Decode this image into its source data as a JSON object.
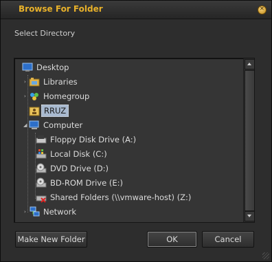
{
  "window": {
    "title": "Browse For Folder"
  },
  "label": "Select Directory",
  "tree": {
    "items": [
      {
        "label": "Desktop",
        "icon": "desktop-icon"
      },
      {
        "label": "Libraries",
        "icon": "libraries-icon"
      },
      {
        "label": "Homegroup",
        "icon": "homegroup-icon"
      },
      {
        "label": "RRUZ",
        "icon": "user-folder-icon",
        "selected": true
      },
      {
        "label": "Computer",
        "icon": "computer-icon",
        "expanded": true
      },
      {
        "label": "Floppy Disk Drive (A:)",
        "icon": "floppy-drive-icon"
      },
      {
        "label": "Local Disk (C:)",
        "icon": "local-disk-icon"
      },
      {
        "label": "DVD Drive (D:)",
        "icon": "dvd-drive-icon"
      },
      {
        "label": "BD-ROM Drive (E:)",
        "icon": "bd-rom-drive-icon"
      },
      {
        "label": "Shared Folders (\\\\vmware-host) (Z:)",
        "icon": "network-drive-icon"
      },
      {
        "label": "Network",
        "icon": "network-icon"
      }
    ]
  },
  "buttons": {
    "make_new_folder": "Make New Folder",
    "ok": "OK",
    "cancel": "Cancel"
  },
  "colors": {
    "title": "#e8b12a",
    "selection": "#a8b9cf",
    "background": "#2d2d2d"
  }
}
